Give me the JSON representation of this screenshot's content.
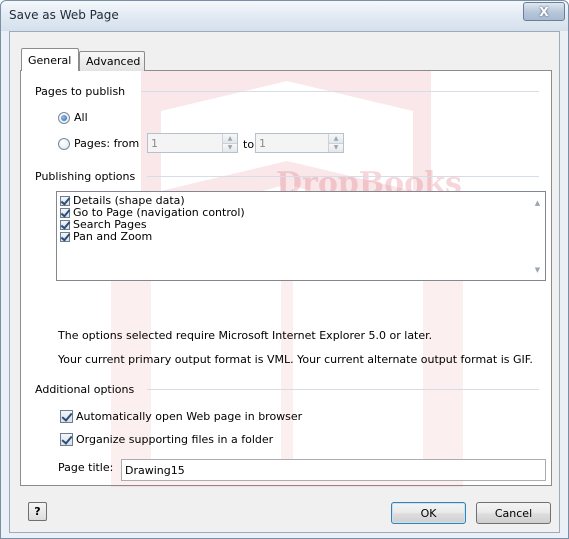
{
  "window": {
    "title": "Save as Web Page",
    "close_glyph": "X"
  },
  "tabs": [
    {
      "label": "General",
      "active": true
    },
    {
      "label": "Advanced",
      "active": false
    }
  ],
  "watermark": {
    "text": "DropBooks",
    "color": "#d94b5a"
  },
  "pages_to_publish": {
    "header": "Pages to publish",
    "all_label": "All",
    "all_selected": true,
    "pages_label": "Pages: from",
    "from_value": "1",
    "to_label": "to",
    "to_value": "1"
  },
  "publishing_options": {
    "header": "Publishing options",
    "items": [
      {
        "label": "Details (shape data)",
        "checked": true
      },
      {
        "label": "Go to Page (navigation control)",
        "checked": true
      },
      {
        "label": "Search Pages",
        "checked": true
      },
      {
        "label": "Pan and Zoom",
        "checked": true
      }
    ],
    "note_1": "The options selected require Microsoft Internet Explorer 5.0 or later.",
    "note_2": "Your current primary output format is VML. Your current alternate output format is GIF."
  },
  "additional_options": {
    "header": "Additional options",
    "auto_open_label": "Automatically open Web page in browser",
    "auto_open_checked": true,
    "organize_label": "Organize supporting files in a folder",
    "organize_checked": true,
    "page_title_label": "Page title:",
    "page_title_value": "Drawing15"
  },
  "buttons": {
    "help_glyph": "?",
    "ok_label": "OK",
    "cancel_label": "Cancel"
  }
}
